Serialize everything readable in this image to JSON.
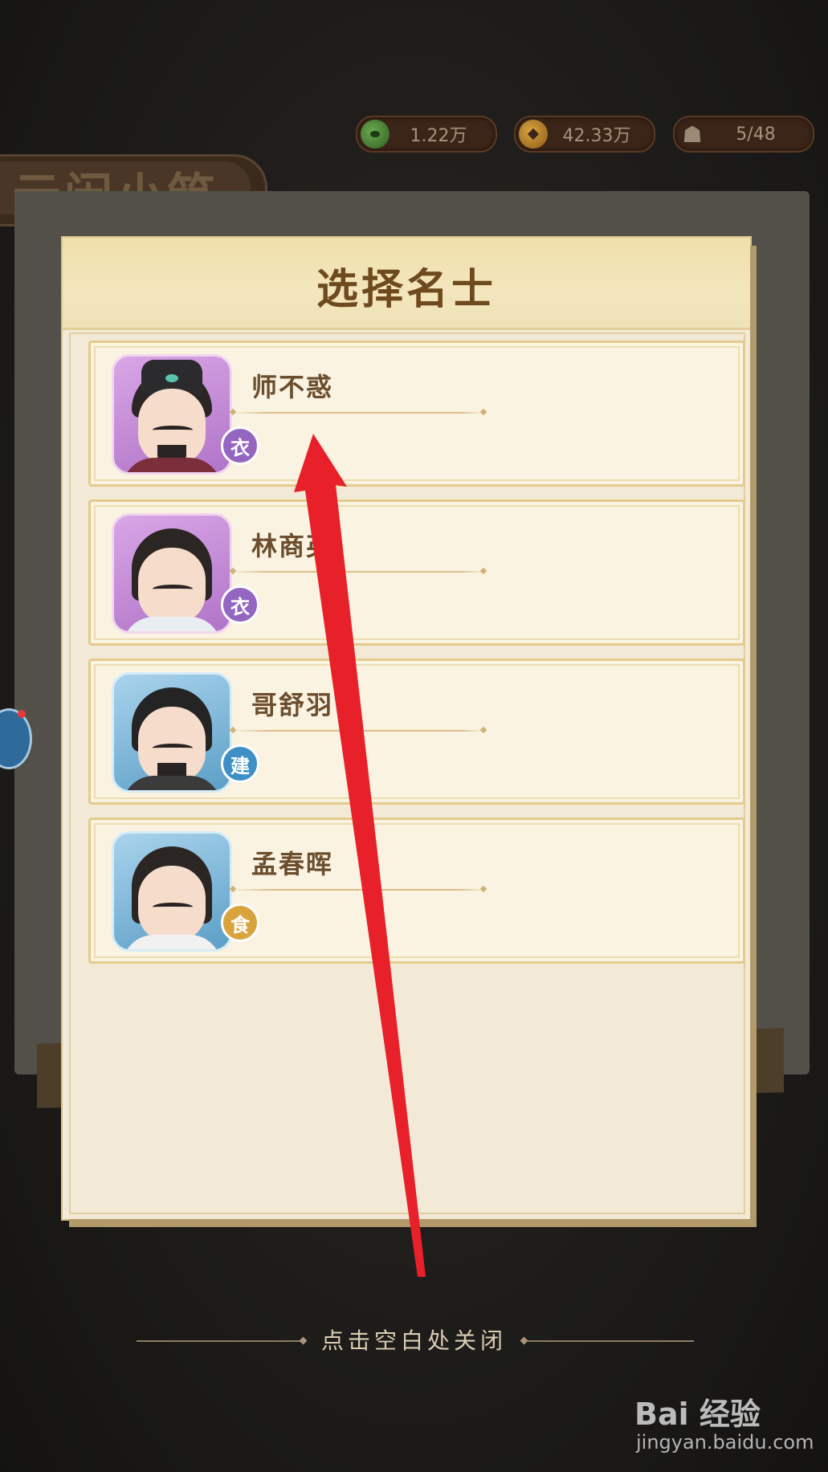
{
  "resources": [
    {
      "icon": "jade-icon",
      "value": "1.22万"
    },
    {
      "icon": "coin-icon",
      "value": "42.33万"
    },
    {
      "icon": "person-icon",
      "value": "5/48"
    }
  ],
  "building": {
    "name": "云闲小筑"
  },
  "panel": {
    "title": "选择名士"
  },
  "scholars": [
    {
      "name": "师不惑",
      "badge": "衣"
    },
    {
      "name": "林商英",
      "badge": "衣"
    },
    {
      "name": "哥舒羽",
      "badge": "建"
    },
    {
      "name": "孟春晖",
      "badge": "食"
    }
  ],
  "close_hint": "点击空白处关闭",
  "watermark": {
    "brand": "Bai 经验",
    "url": "jingyan.baidu.com"
  },
  "colors": {
    "arrow": "#e8202a",
    "title": "#6e4a1e"
  }
}
